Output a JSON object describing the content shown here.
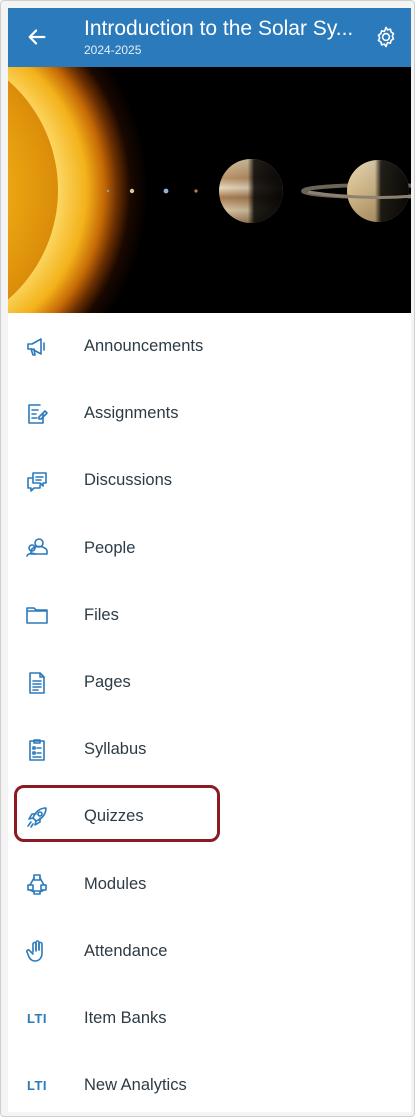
{
  "app_bar": {
    "title": "Introduction to the Solar Sy...",
    "subtitle": "2024-2025",
    "back_icon": "arrow-left-icon",
    "settings_icon": "gear-icon",
    "color": "#2b7abc"
  },
  "banner": {
    "description_icon": "course-image"
  },
  "menu": {
    "items": [
      {
        "label": "Announcements",
        "icon": "megaphone-icon"
      },
      {
        "label": "Assignments",
        "icon": "assignment-icon"
      },
      {
        "label": "Discussions",
        "icon": "discussion-icon"
      },
      {
        "label": "People",
        "icon": "people-icon"
      },
      {
        "label": "Files",
        "icon": "folder-icon"
      },
      {
        "label": "Pages",
        "icon": "page-icon"
      },
      {
        "label": "Syllabus",
        "icon": "syllabus-icon"
      },
      {
        "label": "Quizzes",
        "icon": "rocket-icon",
        "highlighted": true
      },
      {
        "label": "Modules",
        "icon": "modules-icon"
      },
      {
        "label": "Attendance",
        "icon": "hand-icon"
      },
      {
        "label": "Item Banks",
        "icon": "lti-icon",
        "icon_text": "LTI"
      },
      {
        "label": "New Analytics",
        "icon": "lti-icon",
        "icon_text": "LTI"
      }
    ],
    "icon_color": "#2b7abc",
    "label_color": "#2d3b45",
    "highlight_color": "#8b1a23"
  }
}
